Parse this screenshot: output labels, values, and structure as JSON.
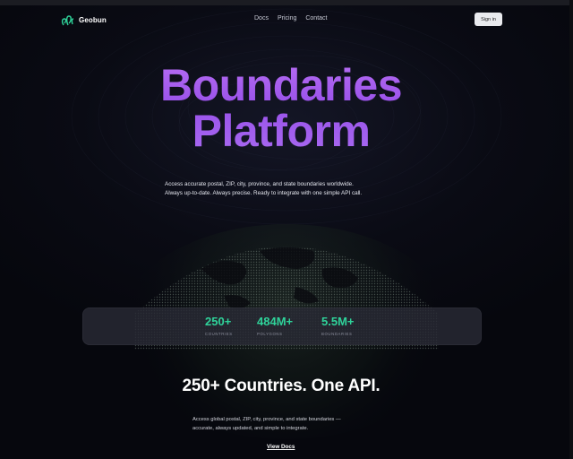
{
  "brand": {
    "name": "Geobun",
    "accent": "#2fd39a",
    "title_gradient": [
      "#b56cf2",
      "#9a52ea"
    ]
  },
  "nav": {
    "links": [
      "Docs",
      "Pricing",
      "Contact"
    ],
    "sign_in_label": "Sign in"
  },
  "hero": {
    "title_lines": [
      "Boundaries",
      "Platform"
    ],
    "subtitle_lines": [
      "Access accurate postal, ZIP, city, province, and state boundaries worldwide.",
      "Always up-to-date. Always precise. Ready to integrate with one simple API call."
    ]
  },
  "stats": [
    {
      "value": "250+",
      "label": "COUNTRIES"
    },
    {
      "value": "484M+",
      "label": "POLYGONS"
    },
    {
      "value": "5.5M+",
      "label": "BOUNDARIES"
    }
  ],
  "section": {
    "title": "250+ Countries. One API.",
    "description_lines": [
      "Access global postal, ZIP, city, province, and state boundaries —",
      "accurate, always updated, and simple to integrate."
    ],
    "cta_label": "View Docs"
  },
  "icons": {
    "logo": "map-pin-cluster-icon"
  }
}
